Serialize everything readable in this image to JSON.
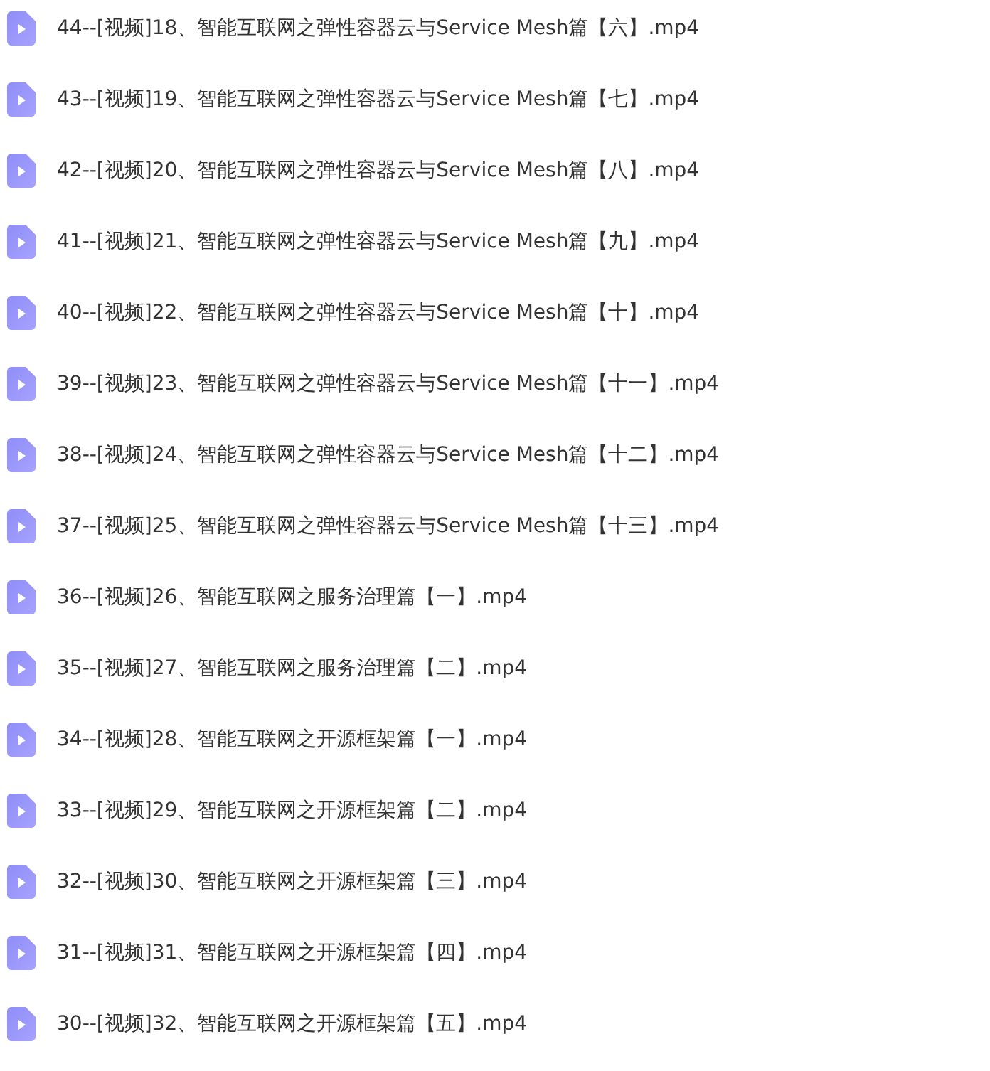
{
  "files": [
    {
      "name": "44--[视频]18、智能互联网之弹性容器云与Service Mesh篇【六】.mp4"
    },
    {
      "name": "43--[视频]19、智能互联网之弹性容器云与Service Mesh篇【七】.mp4"
    },
    {
      "name": "42--[视频]20、智能互联网之弹性容器云与Service Mesh篇【八】.mp4"
    },
    {
      "name": "41--[视频]21、智能互联网之弹性容器云与Service Mesh篇【九】.mp4"
    },
    {
      "name": "40--[视频]22、智能互联网之弹性容器云与Service Mesh篇【十】.mp4"
    },
    {
      "name": "39--[视频]23、智能互联网之弹性容器云与Service Mesh篇【十一】.mp4"
    },
    {
      "name": "38--[视频]24、智能互联网之弹性容器云与Service Mesh篇【十二】.mp4"
    },
    {
      "name": "37--[视频]25、智能互联网之弹性容器云与Service Mesh篇【十三】.mp4"
    },
    {
      "name": "36--[视频]26、智能互联网之服务治理篇【一】.mp4"
    },
    {
      "name": "35--[视频]27、智能互联网之服务治理篇【二】.mp4"
    },
    {
      "name": "34--[视频]28、智能互联网之开源框架篇【一】.mp4"
    },
    {
      "name": "33--[视频]29、智能互联网之开源框架篇【二】.mp4"
    },
    {
      "name": "32--[视频]30、智能互联网之开源框架篇【三】.mp4"
    },
    {
      "name": "31--[视频]31、智能互联网之开源框架篇【四】.mp4"
    },
    {
      "name": "30--[视频]32、智能互联网之开源框架篇【五】.mp4"
    }
  ]
}
